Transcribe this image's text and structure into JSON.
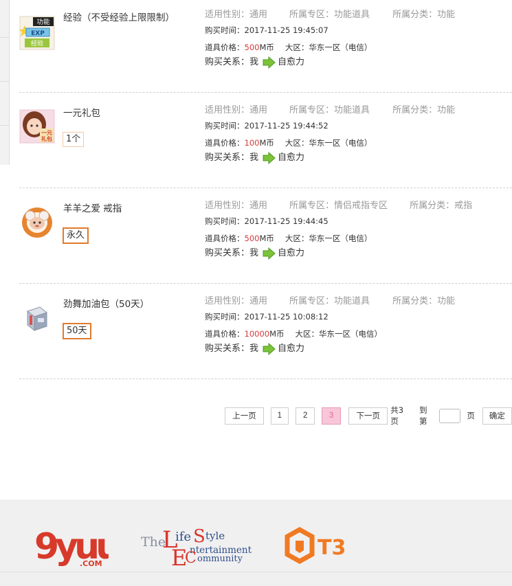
{
  "labels": {
    "gender": "适用性别：",
    "zone": "所属专区：",
    "category": "所属分类：",
    "time": "购买时间：",
    "price": "道具价格：",
    "region": "大区：",
    "relation": "购买关系："
  },
  "items": [
    {
      "name": "经验（不受经验上限限制）",
      "tag": "",
      "gender": "通用",
      "zone": "功能道具",
      "category": "功能",
      "time": "2017-11-25 19:45:07",
      "price": "500",
      "currency": "M币",
      "region": "华东一区（电信）",
      "buyer": "我",
      "recipient": "自愈力",
      "thumb_text_top": "功能",
      "thumb_text_mid": "EXP",
      "thumb_text_bot": "经验"
    },
    {
      "name": "一元礼包",
      "tag": "1个",
      "gender": "通用",
      "zone": "功能道具",
      "category": "功能",
      "time": "2017-11-25 19:44:52",
      "price": "100",
      "currency": "M币",
      "region": "华东一区（电信）",
      "buyer": "我",
      "recipient": "自愈力",
      "thumb_text_top": "一元",
      "thumb_text_bot": "礼包"
    },
    {
      "name": "羊羊之爱 戒指",
      "tag": "永久",
      "gender": "通用",
      "zone": "情侣戒指专区",
      "category": "戒指",
      "time": "2017-11-25 19:44:45",
      "price": "500",
      "currency": "M币",
      "region": "华东一区（电信）",
      "buyer": "我",
      "recipient": "自愈力"
    },
    {
      "name": "劲舞加油包（50天）",
      "tag": "50天",
      "gender": "通用",
      "zone": "功能道具",
      "category": "功能",
      "time": "2017-11-25 10:08:12",
      "price": "10000",
      "currency": "M币",
      "region": "华东一区（电信）",
      "buyer": "我",
      "recipient": "自愈力"
    }
  ],
  "pagination": {
    "prev": "上一页",
    "pages": [
      "1",
      "2",
      "3"
    ],
    "current": "3",
    "next": "下一页",
    "total": "共3页",
    "goto": "到第",
    "page_unit": "页",
    "confirm": "确定"
  },
  "footer": {
    "logo1": "9yuu",
    "logo1_sub": ".COM",
    "logo2_the": "The",
    "logo2_l": "L",
    "logo2_ife": "ife",
    "logo2_s": "S",
    "logo2_tyle": "tyle",
    "logo2_e": "E",
    "logo2_ntertainment": "ntertainment",
    "logo2_c": "C",
    "logo2_ommunity": "ommunity",
    "logo3": "T3"
  },
  "colors": {
    "price_red": "#d63a3a",
    "tag_orange": "#e07a2c",
    "page_current_bg": "#f8c6d8",
    "arrow_green": "#7cc33a"
  }
}
